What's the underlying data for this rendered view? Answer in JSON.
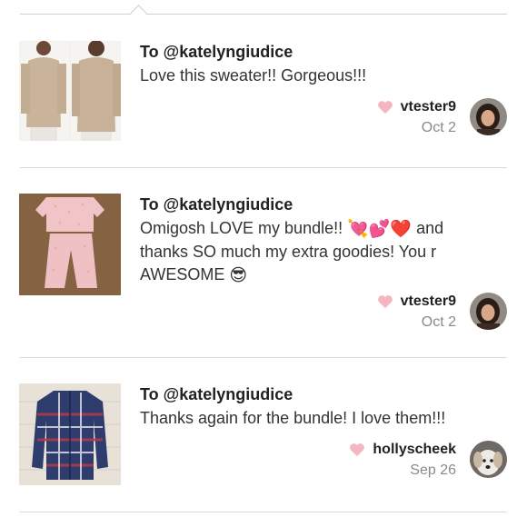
{
  "notes": [
    {
      "to": "To @katelyngiudice",
      "message": "Love this sweater!! Gorgeous!!!",
      "username": "vtester9",
      "date": "Oct 2",
      "thumb_icon": "sweater-photo",
      "avatar_icon": "woman-portrait"
    },
    {
      "to": "To @katelyngiudice",
      "message_lines": [
        "Omigosh LOVE my bundle!! ",
        " and",
        "thanks SO much my extra goodies! You r",
        "AWESOME "
      ],
      "emoji_1": "💘💕❤️",
      "emoji_2": "😎",
      "username": "vtester9",
      "date": "Oct 2",
      "thumb_icon": "pajama-set-photo",
      "avatar_icon": "woman-portrait"
    },
    {
      "to": "To @katelyngiudice",
      "message": "Thanks again for the bundle! I love them!!!",
      "username": "hollyscheek",
      "date": "Sep 26",
      "thumb_icon": "plaid-shirt-photo",
      "avatar_icon": "dog-portrait"
    }
  ],
  "colors": {
    "heart": "#f4b7c1",
    "date": "#8a8a8a",
    "divider": "#d9d9d9"
  }
}
